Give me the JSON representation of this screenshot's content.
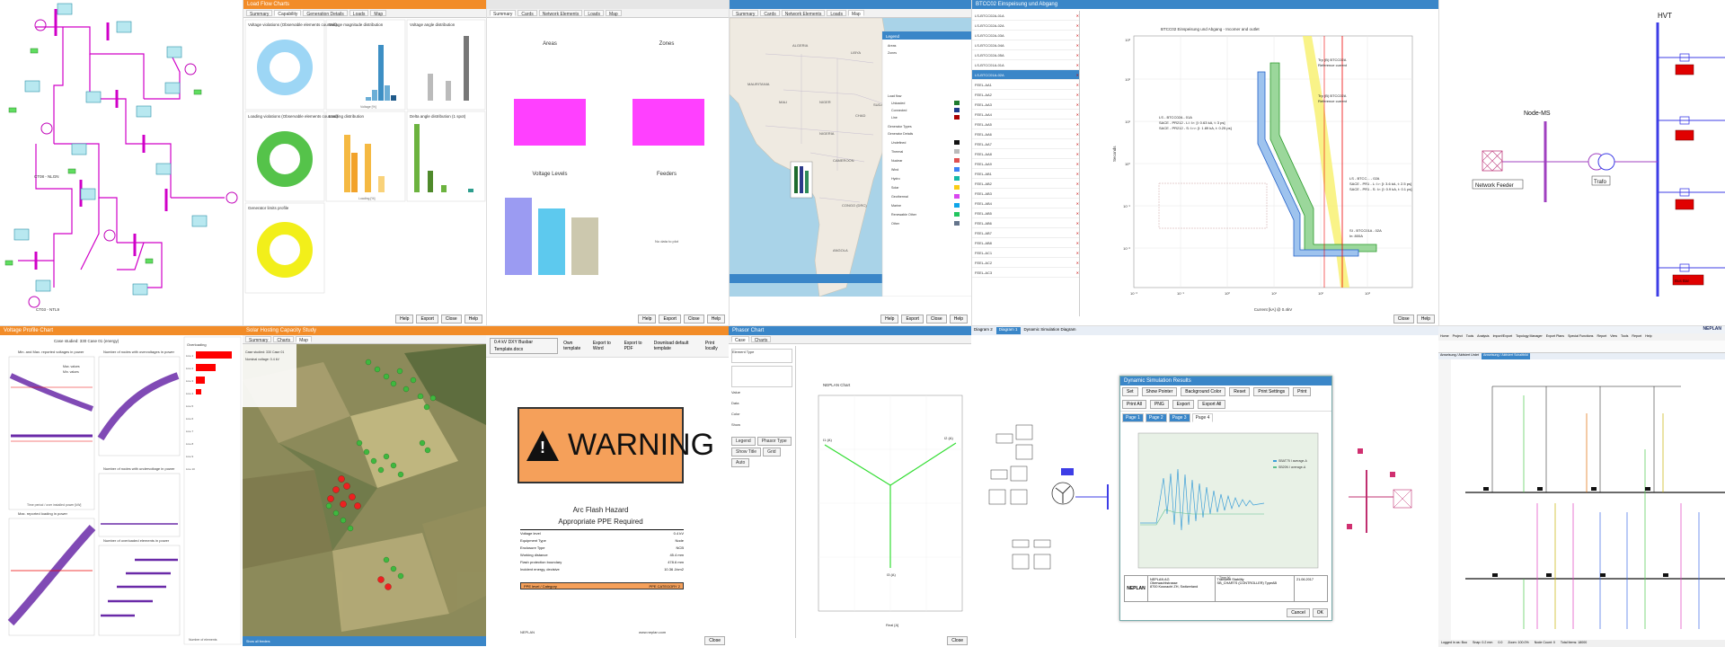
{
  "sld_tl": {
    "nodes": [
      "N3\n220 kV",
      "N4\n220 kV",
      "N5\n220 kV",
      "N6\n220 kV",
      "N7\n220 kV",
      "N8\n220 kV",
      "N10\n220 kV",
      "N11\n220 kV",
      "N12\n220 kV",
      "N13\n220 kV",
      "N14\n220 kV",
      "N15\n220 kV",
      "N16\n220 kV",
      "N17\n220 kV"
    ],
    "labels": [
      "CT08 - NLGN",
      "CT03 - NTL9",
      "C8-N-17N3"
    ]
  },
  "loadflow": {
    "title": "Load Flow Charts",
    "tabs": [
      "Summary",
      "Capability",
      "Generation Details",
      "Loads",
      "Map"
    ],
    "chart_titles": [
      "Voltage violations (Observable elements counted)",
      "Voltage magnitude distribution",
      "Voltage angle distribution",
      "Loading violations (Observable elements counted)",
      "Loading distribution",
      "Delta angle distribution (1 spot)",
      "Generator limits profile"
    ],
    "xlabels": [
      "Voltage [%]",
      "Angle [°]",
      "Loading [%]",
      "dt [°]"
    ],
    "buttons": [
      "Help",
      "Export",
      "Close",
      "Help"
    ]
  },
  "areas": {
    "tabs": [
      "Summary",
      "Cards",
      "Network Elements",
      "Loads",
      "Map"
    ],
    "chart_titles": [
      "Areas",
      "Zones",
      "Voltage Levels",
      "Feeders"
    ],
    "no_data": "No data to plot",
    "buttons": [
      "Help",
      "Export",
      "Close",
      "Help"
    ]
  },
  "map_tile": {
    "tabs": [
      "Summary",
      "Cards",
      "Network Elements",
      "Loads",
      "Map"
    ],
    "countries": [
      "ALGERIA",
      "LIBYA",
      "MAURITANIA",
      "MALI",
      "NIGER",
      "CHAD",
      "SUDAN",
      "NIGERIA",
      "CAMEROON",
      "CONGO (DRC)",
      "ANGOLA"
    ],
    "legend_title": "Legend",
    "legend_items": [
      "Areas",
      "Zones",
      "Load flow",
      "Unloaded",
      "Connected",
      "Line",
      "Generator Types",
      "Generator Details",
      "Undefined",
      "Thermal",
      "Nuclear",
      "Wind",
      "Hydro",
      "Solar",
      "Geothermal",
      "Marine",
      "Renewable Other",
      "Other"
    ],
    "footer": [
      "Help",
      "Export",
      "Close",
      "Help"
    ]
  },
  "overcurrent": {
    "toolbar": "BTCC02 Einspeisung und Abgang",
    "plot_title": "BTCC02 Einspeisung und Abgang - Incomer and outlet",
    "annotations": [
      "Trp (B) BTCC02A",
      "Reference current",
      "Trp (B) BTCC02A",
      "Reference current",
      "LS - BTCC02A - 01A",
      "SACE - PR212 - LI: I>: [l: 0.63 kA, t: 3 ps]",
      "SACE - PR212 - S: I>>: [l: 1.89 kA, t: 0.25 ps]",
      "LS - BTCC... - 02A",
      "SACE - PR1 - L: I>: [l: 3.6 kA, t: 2.5 ps]",
      "SACE - PR1 - S: I>: [l: 0.9 kA, t: 0.1 ps]",
      "SI - BTCC01A - 02A",
      "In: 800A"
    ],
    "xlabel": "Current [kA] @ 0.4kV",
    "ylabel": "Seconds",
    "yticks_left": [
      "10³",
      "10²",
      "10¹",
      "10⁰",
      "10⁻¹",
      "10⁻²"
    ],
    "xticks": [
      "10⁻²",
      "10⁻¹",
      "10⁰",
      "10¹",
      "10²",
      "10³"
    ],
    "list_items": [
      "LS-BTCC02A-01A",
      "LS-BTCC02A-02A",
      "LS-BTCC02A-03A",
      "LS-BTCC02A-04A",
      "LS-BTCC02A-05A",
      "LS-BTCC01A-01A",
      "LS-BTCC01A-02A",
      "FEEL-AA1",
      "FEEL-AA2",
      "FEEL-AA3",
      "FEEL-AA4",
      "FEEL-AA5",
      "FEEL-AA6",
      "FEEL-AA7",
      "FEEL-AA8",
      "FEEL-AA9",
      "FEEL-AB1",
      "FEEL-AB2",
      "FEEL-AB3",
      "FEEL-AB4",
      "FEEL-AB5",
      "FEEL-AB6",
      "FEEL-AB7",
      "FEEL-AB8",
      "FEEL-AC1",
      "FEEL-AC2",
      "FEEL-AC3"
    ],
    "checklist": [
      "Overcurrent",
      "Directional forward",
      "Directional backward",
      "Earth fault",
      "Directional forward",
      "Directional backward"
    ],
    "buttons": [
      "Close",
      "Help"
    ]
  },
  "mv": {
    "labels": {
      "hv": "HVT",
      "node": "Node-MS",
      "feeder": "Network Feeder",
      "trafo": "Trafo"
    },
    "red_boxes": [
      "",
      "",
      "",
      "",
      "Bus Bar"
    ]
  },
  "volt_profile": {
    "tabs": [
      "Voltage Profile Chart"
    ],
    "case": "Case studied: 330 Case 01 (energy)",
    "titles": [
      "Min. and Max. reported voltages in power",
      "Number of nodes with overvoltages in power",
      "Max. reported loading in power",
      "Number of nodes with undervoltage in power",
      "Number of overloaded elements in power"
    ],
    "xlabel": "Time period / over installed power [kW]",
    "legend": [
      "Max. values",
      "Min. values"
    ],
    "side_title": "Overloading",
    "side_items": [
      "Line 1",
      "Line 2",
      "Line 3",
      "Line 4",
      "Line 5",
      "Line 6",
      "Line 7",
      "Line 8",
      "Line 9",
      "Line 10"
    ],
    "footer": "Number of elements"
  },
  "aerial": {
    "title": "Solar Hosting Capacity Study",
    "tabs": [
      "Summary",
      "Charts",
      "Map"
    ],
    "panel_title": "Case studied: 330 Case 01",
    "panel_items": [
      "Nominal voltage: 0.4 kV",
      "..."
    ],
    "status": "Show all feeders"
  },
  "arcflash": {
    "toolbar": [
      "0.4 kV DXY Busbar Template.docx",
      "Own template",
      "Export to Word",
      "Export to PDF",
      "Download default template",
      "Print locally"
    ],
    "warning": "WARNING",
    "hazard": "Arc Flash Hazard",
    "ppe": "Appropriate PPE Required",
    "rows": [
      [
        "Voltage level",
        "0.4 kV"
      ],
      [
        "Equipment Type",
        "Node"
      ],
      [
        "Enclosure Type",
        "NCB"
      ],
      [
        "Working distance",
        "45.4 mm"
      ],
      [
        "Flash protection boundary",
        "478.6 mm"
      ],
      [
        "Incident energy, decisive",
        "10.36 J/cm2"
      ]
    ],
    "footer_row": [
      "PPE level / Category",
      "PPE CATEGORY 2"
    ],
    "logo": "NEPLAN",
    "url": "www.neplan.com",
    "close": "Close"
  },
  "phasor": {
    "title": "Phasor Chart",
    "tabs": [
      "Case",
      "Charts"
    ],
    "plot_title": "NEPLAN Chart",
    "labels": [
      "I1 (A)",
      "I2 (A)",
      "I3 (A)"
    ],
    "xlabel": "Real [A]",
    "form": [
      "Element Type",
      "Value",
      "Data",
      "Color",
      "Show",
      "Phasor",
      "Calculate",
      "Chart"
    ],
    "options": [
      "Legend",
      "Phasor Type",
      "Show Title",
      "Grid",
      "Auto"
    ],
    "close": "Close"
  },
  "dynamic": {
    "tabs": [
      "Diagram 2",
      "Diagram 1",
      "Dynamic Simulation Diagram"
    ],
    "dialog_title": "Dynamic Simulation Results",
    "dialog_tabs": [
      "Page 1",
      "Page 2",
      "Page 3",
      "Page 4"
    ],
    "toolbar": [
      "Set",
      "Show Pointer",
      "Background Color",
      "Reset",
      "Print Settings",
      "Print",
      "Print All",
      "PNG",
      "Export",
      "Export All"
    ],
    "legend": [
      "SBAT75 I average-A",
      "SB20N I average-A"
    ],
    "xlabel": "Time [s]",
    "footer": {
      "company": "NEPLAN AG",
      "line1": "Oberwachtstrasse",
      "line2": "8700 Kusnacht ZH, Switzerland",
      "title": "Transient Stability",
      "subtitle": "SB_CHARTS (CONTROLLER) TypeAB",
      "date": "21.06.2017"
    },
    "buttons": [
      "Cancel",
      "OK"
    ]
  },
  "ribbon": {
    "brand": "NEPLAN",
    "tabs": [
      "Home",
      "Project",
      "Tools",
      "Analysis",
      "Import/Export",
      "Topology Manager",
      "Export Plans",
      "Special Functions",
      "Report",
      "View",
      "Tools",
      "Report",
      "Help"
    ],
    "doc_tabs": [
      "Anweisung / Aktiviert Urdet",
      "Anweisung / Aktiviert Schaltbild"
    ],
    "status": [
      "Logged in as: Boo",
      "Snap: 0.2 mm",
      "0.0",
      "Zoom: 100.0%",
      "Node Count: 0",
      "Total Items: 18000"
    ]
  }
}
